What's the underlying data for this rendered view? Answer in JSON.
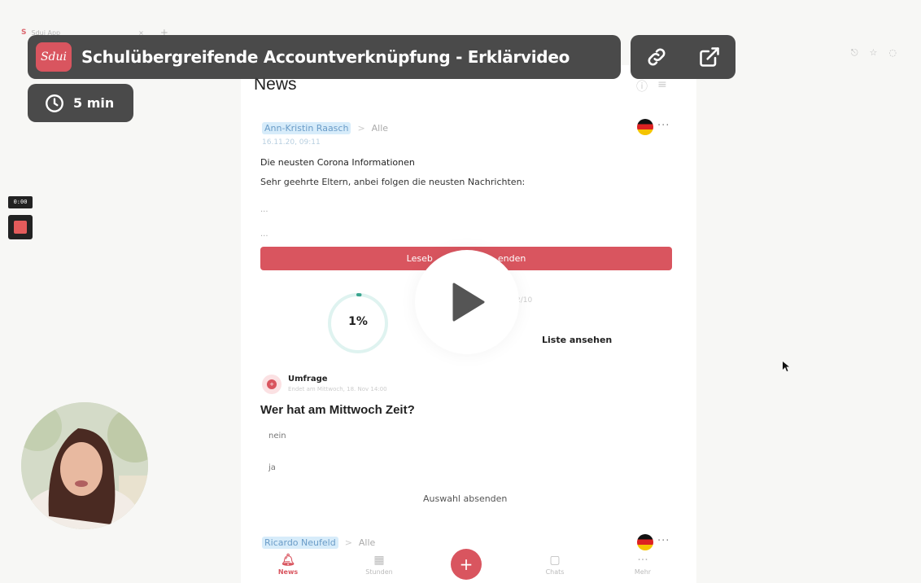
{
  "browser": {
    "tab_title": "Sdui App",
    "tab_close": "×",
    "tab_new": "+",
    "favicon": "S",
    "toolbar_icons": [
      "share-icon",
      "star-icon",
      "profile-icon"
    ]
  },
  "video": {
    "brand_logo": "Sdui",
    "title": "Schulübergreifende Accountverknüpfung - Erklärvideo",
    "duration": "5 min",
    "recording_time": "0:00",
    "actions": [
      "link-icon",
      "external-link-icon"
    ],
    "play_icon": "play-icon",
    "accent_color": "#d9555f",
    "pill_color": "#404040"
  },
  "page": {
    "heading": "News",
    "header_icons": [
      "info-icon",
      "filter-icon"
    ]
  },
  "posts": [
    {
      "author": "Ann-Kristin Raasch",
      "separator": ">",
      "audience": "Alle",
      "date": "16.11.20, 09:11",
      "title": "Die neusten Corona Informationen",
      "body": "Sehr geehrte Eltern, anbei folgen die neusten Nachrichten:",
      "ellipsis_1": "...",
      "ellipsis_2": "...",
      "button_left": "Leseb",
      "button_right": "enden",
      "read_percent": "1%",
      "read_fraction": 0.01,
      "read_count": "2/10",
      "list_link": "Liste ansehen"
    }
  ],
  "poll": {
    "type_label": "Umfrage",
    "deadline": "Endet am Mittwoch, 18. Nov 14:00",
    "question": "Wer hat am Mittwoch Zeit?",
    "options": [
      "nein",
      "ja"
    ],
    "submit_label": "Auswahl absenden"
  },
  "next_post": {
    "author": "Ricardo Neufeld",
    "separator": ">",
    "audience": "Alle"
  },
  "bottom_nav": {
    "items": [
      {
        "label": "News",
        "icon": "bell-icon"
      },
      {
        "label": "Stunden",
        "icon": "calendar-icon"
      },
      {
        "label": "Chats",
        "icon": "chat-icon"
      },
      {
        "label": "Mehr",
        "icon": "more-icon"
      }
    ],
    "fab_label": "+"
  }
}
